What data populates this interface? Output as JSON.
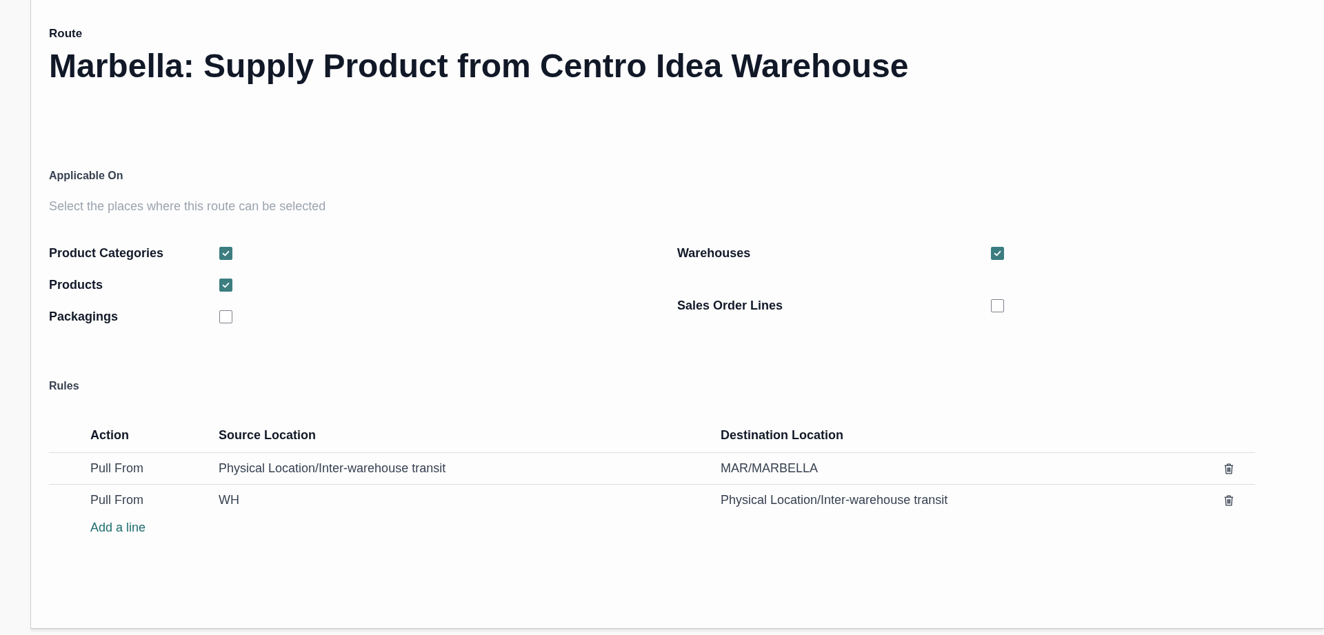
{
  "form": {
    "record_label": "Route",
    "title": "Marbella: Supply Product from Centro Idea Warehouse"
  },
  "applicable_on": {
    "label": "Applicable On",
    "description": "Select the places where this route can be selected",
    "left_options": [
      {
        "label": "Product Categories",
        "checked": true
      },
      {
        "label": "Products",
        "checked": true
      },
      {
        "label": "Packagings",
        "checked": false
      }
    ],
    "right_options": [
      {
        "label": "Warehouses",
        "checked": true
      },
      {
        "label": "Sales Order Lines",
        "checked": false
      }
    ]
  },
  "rules": {
    "label": "Rules",
    "columns": [
      "Action",
      "Source Location",
      "Destination Location"
    ],
    "rows": [
      {
        "action": "Pull From",
        "source": "Physical Location/Inter-warehouse transit",
        "destination": "MAR/MARBELLA"
      },
      {
        "action": "Pull From",
        "source": "WH",
        "destination": "Physical Location/Inter-warehouse transit"
      }
    ],
    "add_line": "Add a line"
  }
}
